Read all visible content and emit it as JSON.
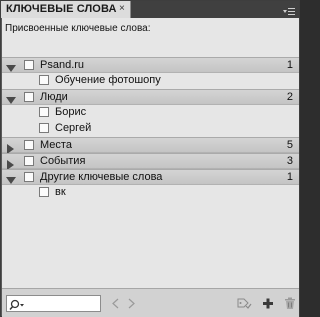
{
  "panel": {
    "tab_label": "КЛЮЧЕВЫЕ СЛОВА",
    "close_glyph": "×",
    "assigned_label": "Присвоенные ключевые слова:"
  },
  "groups": [
    {
      "label": "Psand.ru",
      "count": "1",
      "expanded": true,
      "children": [
        "Обучение фотошопу"
      ]
    },
    {
      "label": "Люди",
      "count": "2",
      "expanded": true,
      "children": [
        "Борис",
        "Сергей"
      ]
    },
    {
      "label": "Места",
      "count": "5",
      "expanded": false,
      "children": []
    },
    {
      "label": "События",
      "count": "3",
      "expanded": false,
      "children": []
    },
    {
      "label": "Другие ключевые слова",
      "count": "1",
      "expanded": true,
      "children": [
        "вк"
      ]
    }
  ],
  "bottom": {
    "search_value": "",
    "icons": [
      "previous-icon",
      "next-icon",
      "apply-keyword-icon",
      "new-keyword-icon",
      "delete-icon"
    ]
  },
  "colors": {
    "panel_bg": "#e6e6e6",
    "group_row_bg": "#cacaca",
    "tab_bg": "#dcdcdc",
    "chrome_dark": "#404040"
  }
}
